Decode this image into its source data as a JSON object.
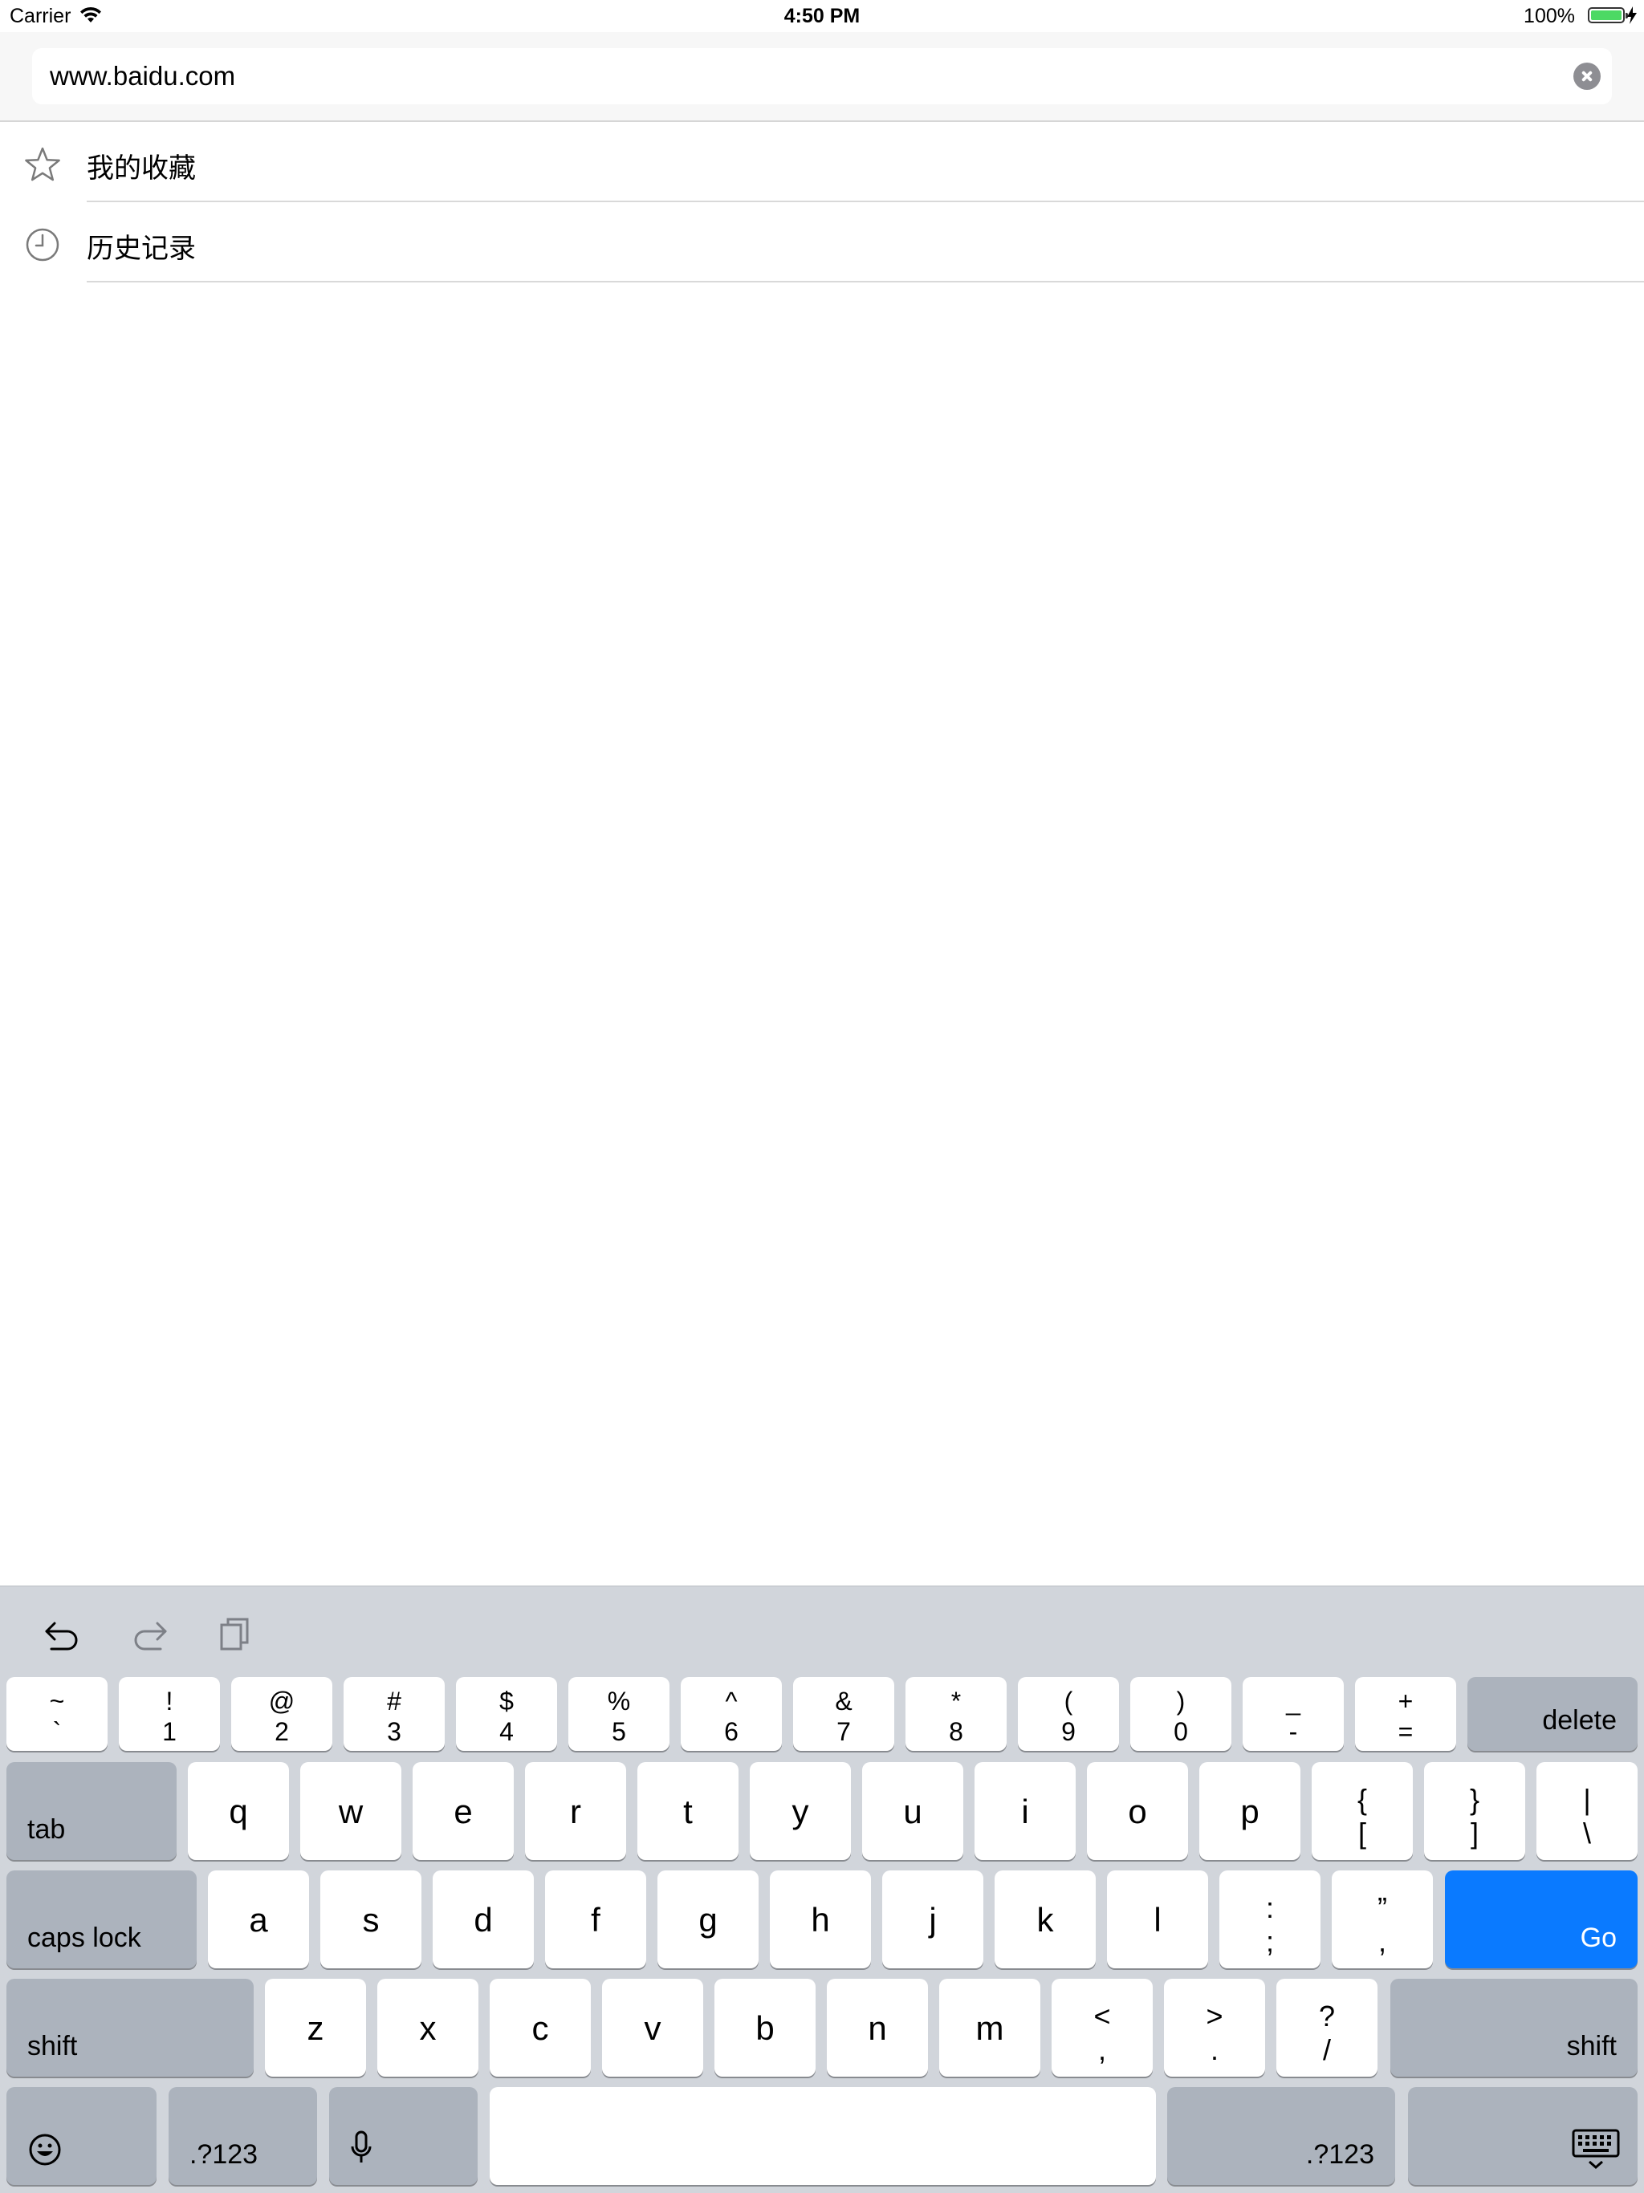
{
  "status_bar": {
    "carrier": "Carrier",
    "time": "4:50 PM",
    "battery": "100%"
  },
  "url_bar": {
    "value": "www.baidu.com"
  },
  "menu": [
    {
      "label": "我的收藏",
      "icon": "star-icon"
    },
    {
      "label": "历史记录",
      "icon": "clock-icon"
    }
  ],
  "keyboard": {
    "number_row": [
      {
        "top": "~",
        "bottom": "`"
      },
      {
        "top": "!",
        "bottom": "1"
      },
      {
        "top": "@",
        "bottom": "2"
      },
      {
        "top": "#",
        "bottom": "3"
      },
      {
        "top": "$",
        "bottom": "4"
      },
      {
        "top": "%",
        "bottom": "5"
      },
      {
        "top": "^",
        "bottom": "6"
      },
      {
        "top": "&",
        "bottom": "7"
      },
      {
        "top": "*",
        "bottom": "8"
      },
      {
        "top": "(",
        "bottom": "9"
      },
      {
        "top": ")",
        "bottom": "0"
      },
      {
        "top": "_",
        "bottom": "-"
      },
      {
        "top": "+",
        "bottom": "="
      }
    ],
    "delete": "delete",
    "tab": "tab",
    "row_q": [
      "q",
      "w",
      "e",
      "r",
      "t",
      "y",
      "u",
      "i",
      "o",
      "p"
    ],
    "row_q_symbols": [
      {
        "top": "{",
        "bottom": "["
      },
      {
        "top": "}",
        "bottom": "]"
      },
      {
        "top": "|",
        "bottom": "\\"
      }
    ],
    "caps_lock": "caps lock",
    "row_a": [
      "a",
      "s",
      "d",
      "f",
      "g",
      "h",
      "j",
      "k",
      "l"
    ],
    "row_a_symbols": [
      {
        "top": ":",
        "bottom": ";"
      },
      {
        "top": "”",
        "bottom": ","
      }
    ],
    "go": "Go",
    "shift": "shift",
    "row_z": [
      "z",
      "x",
      "c",
      "v",
      "b",
      "n",
      "m"
    ],
    "row_z_symbols": [
      {
        "top": "<",
        "bottom": ","
      },
      {
        "top": ">",
        "bottom": "."
      },
      {
        "top": "?",
        "bottom": "/"
      }
    ],
    "numbers_key": ".?123",
    "accent_color": "#0a7aff"
  }
}
